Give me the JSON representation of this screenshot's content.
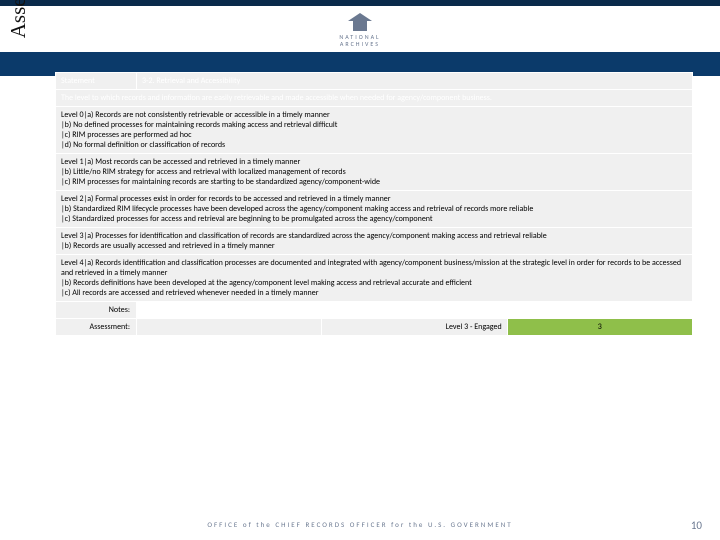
{
  "branding": {
    "org_top": "NATIONAL",
    "org_bottom": "ARCHIVES",
    "footer_line": "OFFICE of the CHIEF RECORDS OFFICER for the U.S. GOVERNMENT"
  },
  "sidebar_title": "Assessment Criteria Example",
  "statement": {
    "label": "Statement",
    "code": "3-2. Retrieval and Accessibility",
    "description": "The level to which records and information are easily retrievable and made accessible when needed for agency/component business."
  },
  "levels": [
    {
      "name": "Level 0",
      "items": [
        "|a) Records are not consistently retrievable or accessible in a timely manner",
        "|b) No defined processes for maintaining records making access and retrieval difficult",
        "|c) RIM processes are performed ad hoc",
        "|d) No formal definition or classification of records"
      ]
    },
    {
      "name": "Level 1",
      "items": [
        "|a) Most records can be accessed and retrieved in a timely manner",
        "|b) Little/no RIM strategy for access and retrieval with localized management of records",
        "|c) RIM processes for maintaining records are starting to be standardized agency/component-wide"
      ]
    },
    {
      "name": "Level 2",
      "items": [
        "|a) Formal processes exist in order for records to be accessed and retrieved in a timely manner",
        "|b) Standardized RIM lifecycle processes have been developed across the agency/component making access and retrieval of records more reliable",
        "|c) Standardized processes for access and retrieval are beginning to be promulgated across the agency/component"
      ]
    },
    {
      "name": "Level 3",
      "items": [
        "|a) Processes for identification and classification of records are standardized across the agency/component making access and retrieval reliable",
        "|b) Records are usually accessed and retrieved in a timely manner"
      ]
    },
    {
      "name": "Level 4",
      "items": [
        "|a) Records identification and classification processes are documented and integrated with agency/component business/mission at the strategic level in order for records to be accessed and retrieved in a timely manner",
        "|b) Records definitions have been developed at the agency/component level making access and retrieval accurate and efficient",
        "|c) All records are accessed and retrieved whenever needed in a timely manner"
      ]
    }
  ],
  "notes_label": "Notes:",
  "assessment": {
    "label": "Assessment:",
    "result_text": "Level 3 - Engaged",
    "score": "3"
  },
  "page_number": "10"
}
